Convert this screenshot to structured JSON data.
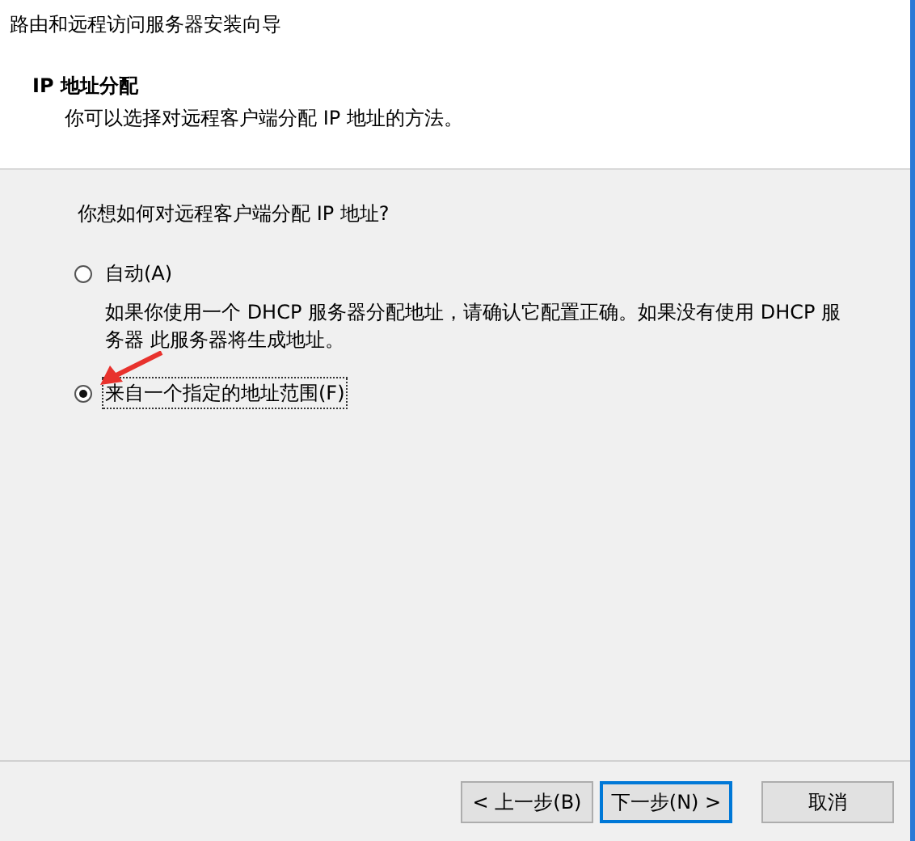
{
  "window": {
    "title": "路由和远程访问服务器安装向导"
  },
  "header": {
    "title": "IP 地址分配",
    "subtitle": "你可以选择对远程客户端分配 IP 地址的方法。"
  },
  "question": "你想如何对远程客户端分配 IP 地址?",
  "options": [
    {
      "label": "自动(A)",
      "selected": false,
      "description": "如果你使用一个 DHCP 服务器分配地址，请确认它配置正确。如果没有使用 DHCP 服务器 此服务器将生成地址。"
    },
    {
      "label": "来自一个指定的地址范围(F)",
      "selected": true
    }
  ],
  "buttons": [
    {
      "label": "< 上一步(B)",
      "kind": "normal"
    },
    {
      "label": "下一步(N) >",
      "kind": "default"
    },
    {
      "label": "取消",
      "kind": "normal"
    }
  ]
}
